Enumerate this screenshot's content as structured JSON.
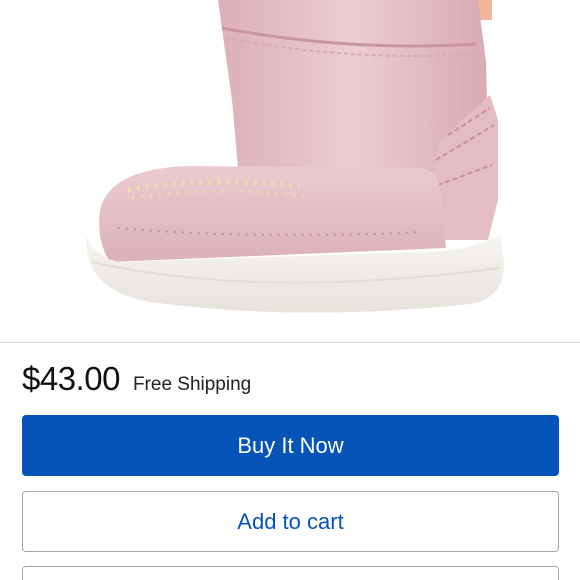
{
  "listing": {
    "price": "$43.00",
    "shipping": "Free Shipping"
  },
  "actions": {
    "buy_it_now": "Buy It Now",
    "add_to_cart": "Add to cart"
  },
  "colors": {
    "primary_blue": "#0654ba",
    "border_gray": "#a7a7a7",
    "product_pink": "#e9c6cc"
  }
}
